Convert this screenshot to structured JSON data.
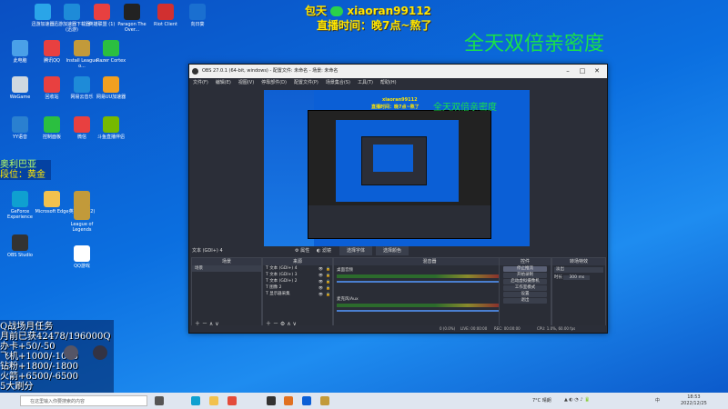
{
  "overlay": {
    "line1_prefix": "包天",
    "line1_id": "xiaoran99112",
    "line2": "直播时间：晚7点~熬了",
    "big_title": "全天双倍亲密度"
  },
  "rank_box": {
    "line1": "奥利巴亚",
    "line2": "段位：黄金"
  },
  "desktop_icons": [
    {
      "label": "迅游加速器"
    },
    {
      "label": "迅游加速器下载器(迅游)"
    },
    {
      "label": "英雄联盟 (1)"
    },
    {
      "label": "Paragon The Over..."
    },
    {
      "label": "Riot Client"
    },
    {
      "label": "向日葵"
    },
    {
      "label": "此电脑"
    },
    {
      "label": "腾讯QQ"
    },
    {
      "label": "Install League o..."
    },
    {
      "label": "Razer Cortex"
    },
    {
      "label": "WeGame"
    },
    {
      "label": "回收站"
    },
    {
      "label": "网易云音乐"
    },
    {
      "label": "网易UU加速器"
    },
    {
      "label": "YY语音"
    },
    {
      "label": "控制面板"
    },
    {
      "label": "微信"
    },
    {
      "label": "斗鱼直播伴侣"
    },
    {
      "label": "GeForce Experience"
    },
    {
      "label": "Microsoft Edge"
    },
    {
      "label": "英雄联盟 (2)"
    },
    {
      "label": "League of Legends"
    },
    {
      "label": "OBS Studio"
    },
    {
      "label": "QQ游戏"
    }
  ],
  "obs": {
    "title": "OBS 27.0.1 (64-bit, windows) - 配置文件: 未命名 - 场景: 未命名",
    "menu": [
      "文件(F)",
      "编辑(E)",
      "视图(V)",
      "停靠部件(D)",
      "配置文件(P)",
      "场景集合(S)",
      "工具(T)",
      "帮助(H)"
    ],
    "source_label": "文本 (GDI+) 4",
    "source_buttons": [
      "属性",
      "滤镜",
      "选择字体",
      "选择颜色"
    ],
    "panels": {
      "scenes": {
        "header": "场景",
        "items": [
          "场景"
        ]
      },
      "sources": {
        "header": "来源",
        "items": [
          "文本 (GDI+) 4",
          "文本 (GDI+) 3",
          "文本 (GDI+) 2",
          "图像 2",
          "显示器采集"
        ]
      },
      "mixer": {
        "header": "混音器",
        "channels": [
          {
            "name": "桌面音频",
            "db": "0.0 dB"
          },
          {
            "name": "麦克风/Aux",
            "db": "0.0 dB"
          }
        ]
      },
      "transitions": {
        "header": "转场特效",
        "type": "淡出",
        "duration_label": "时长",
        "duration": "300 ms"
      },
      "controls": {
        "header": "控件",
        "buttons": [
          "停止推流",
          "开始录制",
          "启动虚拟摄像机",
          "工作室模式",
          "设置",
          "退出"
        ]
      }
    },
    "status": {
      "drop": "0 (0.0%)",
      "live": "LIVE: 00:00:00",
      "rec": "REC: 00:00:00",
      "cpu": "CPU: 1.0%, 60.00 fps"
    }
  },
  "stats_panel": {
    "lines": [
      "Q战场月任务",
      "月前已获42478/196000Q",
      "办卡+50/-50",
      "飞机+1000/-1000",
      "钻粉+1800/-1800",
      "火箭+6500/-6500",
      "5大刷分"
    ]
  },
  "taskbar": {
    "search_placeholder": "在这里输入你要搜索的内容",
    "weather": "7°C 晴朗",
    "time": "18:53",
    "date": "2022/12/25",
    "ime": "中"
  },
  "colors": {
    "desktop": "#0b6fe0",
    "overlay_yellow": "#ffe600",
    "overlay_green": "#19e04a"
  }
}
